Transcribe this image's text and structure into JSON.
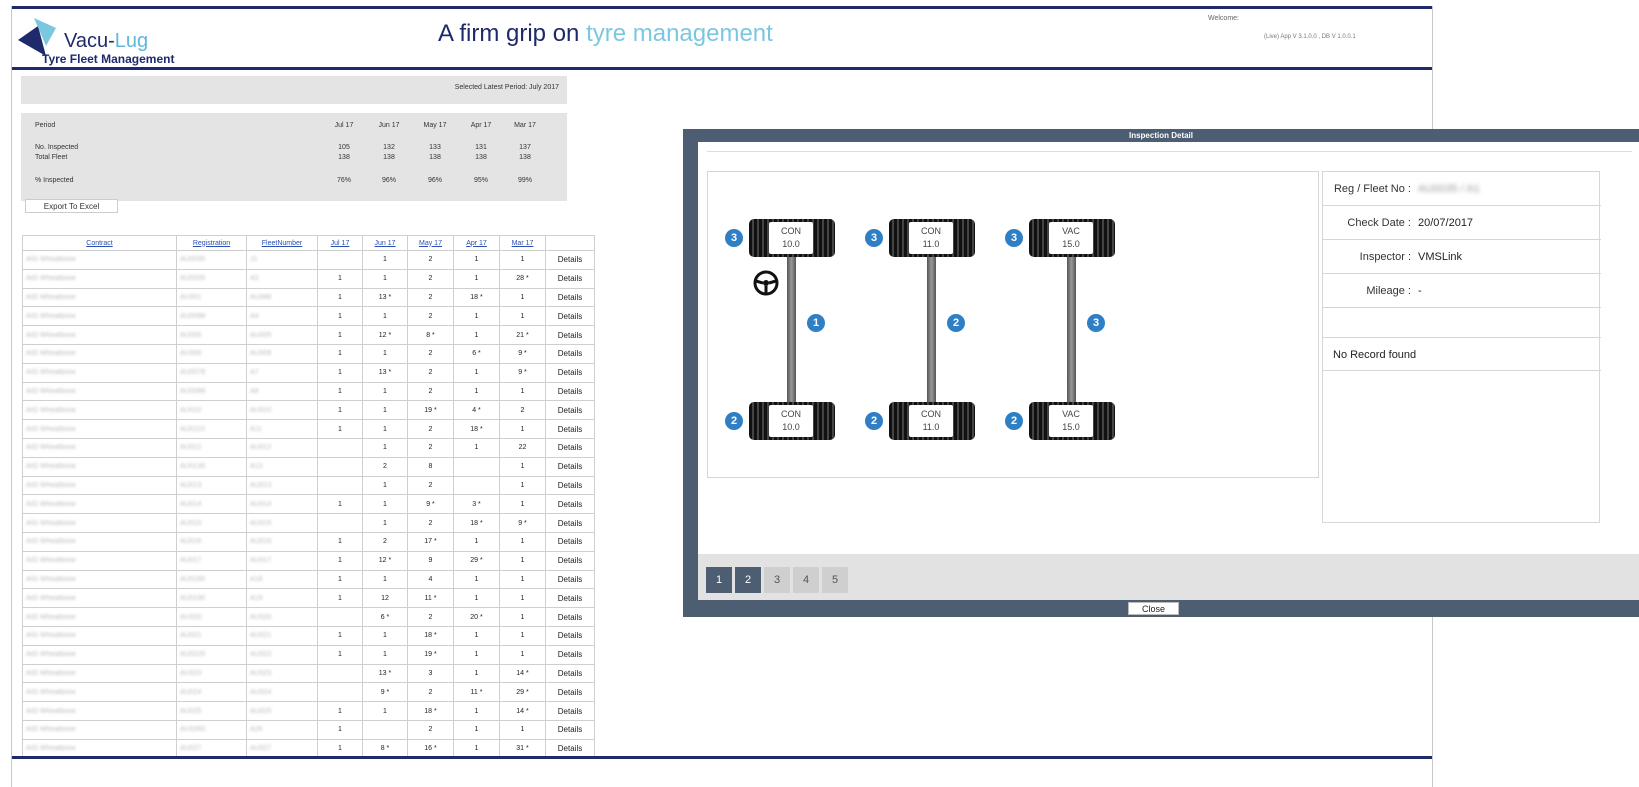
{
  "header": {
    "brand_part1": "Vacu-",
    "brand_part2": "Lug",
    "brand_sub": "Tyre Fleet Management",
    "tagline_part1": "A firm grip on ",
    "tagline_part2": "tyre management",
    "welcome": "Welcome:",
    "version": "(Live) App V 3.1.0.0 , DB V 1.0.0.1"
  },
  "period_banner": "Selected Latest Period: July 2017",
  "summary": {
    "label_period": "Period",
    "periods": [
      "Jul 17",
      "Jun 17",
      "May 17",
      "Apr 17",
      "Mar 17"
    ],
    "label_inspected": "No. Inspected",
    "inspected": [
      "105",
      "132",
      "133",
      "131",
      "137"
    ],
    "label_total": "Total Fleet",
    "total": [
      "138",
      "138",
      "138",
      "138",
      "138"
    ],
    "label_pct": "% Inspected",
    "pct": [
      "76%",
      "96%",
      "96%",
      "95%",
      "99%"
    ]
  },
  "export_label": "Export To Excel",
  "table": {
    "headers": [
      "Contract",
      "Registration",
      "FleetNumber",
      "Jul 17",
      "Jun 17",
      "May 17",
      "Apr 17",
      "Mar 17",
      ""
    ],
    "details_label": "Details",
    "rows": [
      [
        "AIG Wheatbone",
        "AU0035",
        "J1",
        "",
        "1",
        "2",
        "1",
        "1"
      ],
      [
        "AIG Wheatbone",
        "AU0326",
        "A3",
        "1",
        "1",
        "2",
        "1",
        "28 *"
      ],
      [
        "AIG Wheatbone",
        "AU001",
        "AU088",
        "1",
        "13 *",
        "2",
        "18 *",
        "1"
      ],
      [
        "AIG Wheatbone",
        "AU0098",
        "A4",
        "1",
        "1",
        "2",
        "1",
        "1"
      ],
      [
        "AIG Wheatbone",
        "AU005",
        "AU005",
        "1",
        "12 *",
        "8 *",
        "1",
        "21 *"
      ],
      [
        "AIG Wheatbone",
        "AU006",
        "AU006",
        "1",
        "1",
        "2",
        "6 *",
        "9 *"
      ],
      [
        "AIG Wheatbone",
        "AU0078",
        "A7",
        "1",
        "13 *",
        "2",
        "1",
        "9 *"
      ],
      [
        "AIG Wheatbone",
        "AU0088",
        "A8",
        "1",
        "1",
        "2",
        "1",
        "1"
      ],
      [
        "AIG Wheatbone",
        "AU010",
        "AU010",
        "1",
        "1",
        "19 *",
        "4 *",
        "2"
      ],
      [
        "AIG Wheatbone",
        "AU0110",
        "A11",
        "1",
        "1",
        "2",
        "18 *",
        "1"
      ],
      [
        "AIG Wheatbone",
        "AU012",
        "AU012",
        "",
        "1",
        "2",
        "1",
        "22"
      ],
      [
        "AIG Wheatbone",
        "AU0130",
        "A13",
        "",
        "2",
        "8",
        "",
        "1"
      ],
      [
        "AIG Wheatbone",
        "AU013",
        "AU013",
        "",
        "1",
        "2",
        "",
        "1"
      ],
      [
        "AIG Wheatbone",
        "AU014",
        "AU014",
        "1",
        "1",
        "9 *",
        "3 *",
        "1"
      ],
      [
        "AIG Wheatbone",
        "AU015",
        "AU015",
        "",
        "1",
        "2",
        "18 *",
        "9 *"
      ],
      [
        "AIG Wheatbone",
        "AU016",
        "AU016",
        "1",
        "2",
        "17 *",
        "1",
        "1"
      ],
      [
        "AIG Wheatbone",
        "AU017",
        "AU017",
        "1",
        "12 *",
        "9",
        "29 *",
        "1"
      ],
      [
        "AIG Wheatbone",
        "AU0180",
        "A18",
        "1",
        "1",
        "4",
        "1",
        "1"
      ],
      [
        "AIG Wheatbone",
        "AU0190",
        "A19",
        "1",
        "12",
        "11 *",
        "1",
        "1"
      ],
      [
        "AIG Wheatbone",
        "AU020",
        "AU020",
        "",
        "6 *",
        "2",
        "20 *",
        "1"
      ],
      [
        "AIG Wheatbone",
        "AU021",
        "AU021",
        "1",
        "1",
        "18 *",
        "1",
        "1"
      ],
      [
        "AIG Wheatbone",
        "AU0220",
        "AU022",
        "1",
        "1",
        "19 *",
        "1",
        "1"
      ],
      [
        "AIG Wheatbone",
        "AU023",
        "AU023",
        "",
        "13 *",
        "3",
        "1",
        "14 *"
      ],
      [
        "AIG Wheatbone",
        "AU024",
        "AU024",
        "",
        "9 *",
        "2",
        "11 *",
        "29 *"
      ],
      [
        "AIG Wheatbone",
        "AU025",
        "AU025",
        "1",
        "1",
        "18 *",
        "1",
        "14 *"
      ],
      [
        "AIG Wheatbone",
        "AU0260",
        "A26",
        "1",
        "",
        "2",
        "1",
        "1"
      ],
      [
        "AIG Wheatbone",
        "AU027",
        "AU027",
        "1",
        "8 *",
        "16 *",
        "1",
        "31 *"
      ]
    ]
  },
  "modal": {
    "title": "Inspection Detail",
    "reg_label": "Reg / Fleet No :",
    "reg_value": "AU0035 / A1",
    "date_label": "Check Date :",
    "date_value": "20/07/2017",
    "inspector_label": "Inspector :",
    "inspector_value": "VMSLink",
    "mileage_label": "Mileage :",
    "mileage_value": "-",
    "no_record": "No Record found",
    "pages": [
      "1",
      "2",
      "3",
      "4",
      "5"
    ],
    "close_label": "Close",
    "axles": [
      {
        "num": "1",
        "top_badge": "3",
        "bottom_badge": "2",
        "top_type": "CON",
        "top_val": "10.0",
        "bottom_type": "CON",
        "bottom_val": "10.0"
      },
      {
        "num": "2",
        "top_badge": "3",
        "bottom_badge": "2",
        "top_type": "CON",
        "top_val": "11.0",
        "bottom_type": "CON",
        "bottom_val": "11.0"
      },
      {
        "num": "3",
        "top_badge": "3",
        "bottom_badge": "2",
        "top_type": "VAC",
        "top_val": "15.0",
        "bottom_type": "VAC",
        "bottom_val": "15.0"
      }
    ],
    "colors": {
      "frame": "#4d5e73",
      "badge": "#2f7fc4"
    },
    "icons": {
      "steering": "steering-wheel-icon"
    }
  }
}
